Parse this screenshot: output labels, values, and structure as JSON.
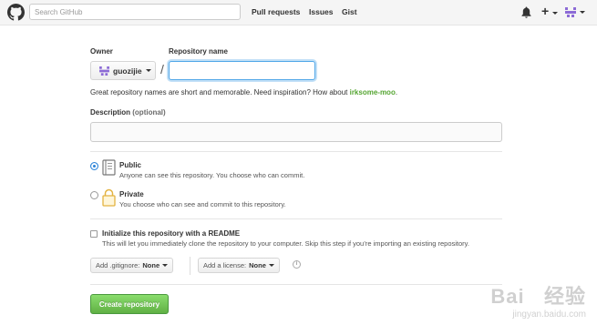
{
  "header": {
    "search_placeholder": "Search GitHub",
    "nav": [
      "Pull requests",
      "Issues",
      "Gist"
    ]
  },
  "form": {
    "owner_label": "Owner",
    "owner_name": "guozijie",
    "slash": "/",
    "repo_label": "Repository name",
    "repo_value": "",
    "hint_prefix": "Great repository names are short and memorable. Need inspiration? How about ",
    "hint_suggestion": "irksome-moo",
    "hint_suffix": ".",
    "description_label": "Description",
    "description_optional": "(optional)",
    "description_value": "",
    "visibility": {
      "selected": "public",
      "public_title": "Public",
      "public_desc": "Anyone can see this repository. You choose who can commit.",
      "private_title": "Private",
      "private_desc": "You choose who can see and commit to this repository."
    },
    "init_readme": {
      "checked": false,
      "title": "Initialize this repository with a README",
      "desc": "This will let you immediately clone the repository to your computer. Skip this step if you’re importing an existing repository."
    },
    "gitignore": {
      "label": "Add .gitignore:",
      "value": "None"
    },
    "license": {
      "label": "Add a license:",
      "value": "None"
    },
    "info_icon": "i",
    "create_label": "Create repository"
  },
  "watermark": {
    "brand": "Bai   经验",
    "url": "jingyan.baidu.com"
  },
  "colors": {
    "accent_blue": "#2a83d8",
    "suggest_green": "#55a532",
    "create_green": "#60b044"
  }
}
